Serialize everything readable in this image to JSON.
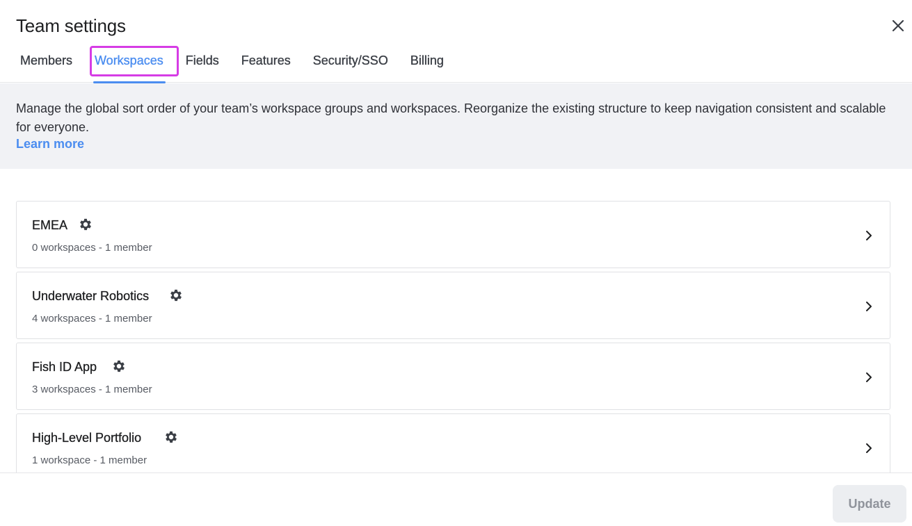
{
  "header": {
    "title": "Team settings",
    "close_icon": "close-icon"
  },
  "tabs": [
    {
      "label": "Members",
      "active": false
    },
    {
      "label": "Workspaces",
      "active": true
    },
    {
      "label": "Fields",
      "active": false
    },
    {
      "label": "Features",
      "active": false
    },
    {
      "label": "Security/SSO",
      "active": false
    },
    {
      "label": "Billing",
      "active": false
    }
  ],
  "info": {
    "description": "Manage the global sort order of your team’s workspace groups and workspaces. Reorganize the existing structure to keep navigation consistent and scalable for everyone.",
    "learn_more": "Learn more"
  },
  "workspace_groups": [
    {
      "name": "EMEA",
      "summary": "0 workspaces - 1 member",
      "icon": "gear-icon"
    },
    {
      "name": "Underwater Robotics",
      "summary": "4 workspaces - 1 member",
      "icon": "gear-icon"
    },
    {
      "name": "Fish ID App",
      "summary": "3 workspaces - 1 member",
      "icon": "gear-icon"
    },
    {
      "name": "High-Level Portfolio",
      "summary": "1 workspace - 1 member",
      "icon": "gear-icon"
    }
  ],
  "footer": {
    "update_label": "Update"
  },
  "colors": {
    "accent": "#4b8df0",
    "highlight": "#d63ce5",
    "info_bg": "#f1f2f5",
    "disabled_bg": "#eceef1"
  }
}
